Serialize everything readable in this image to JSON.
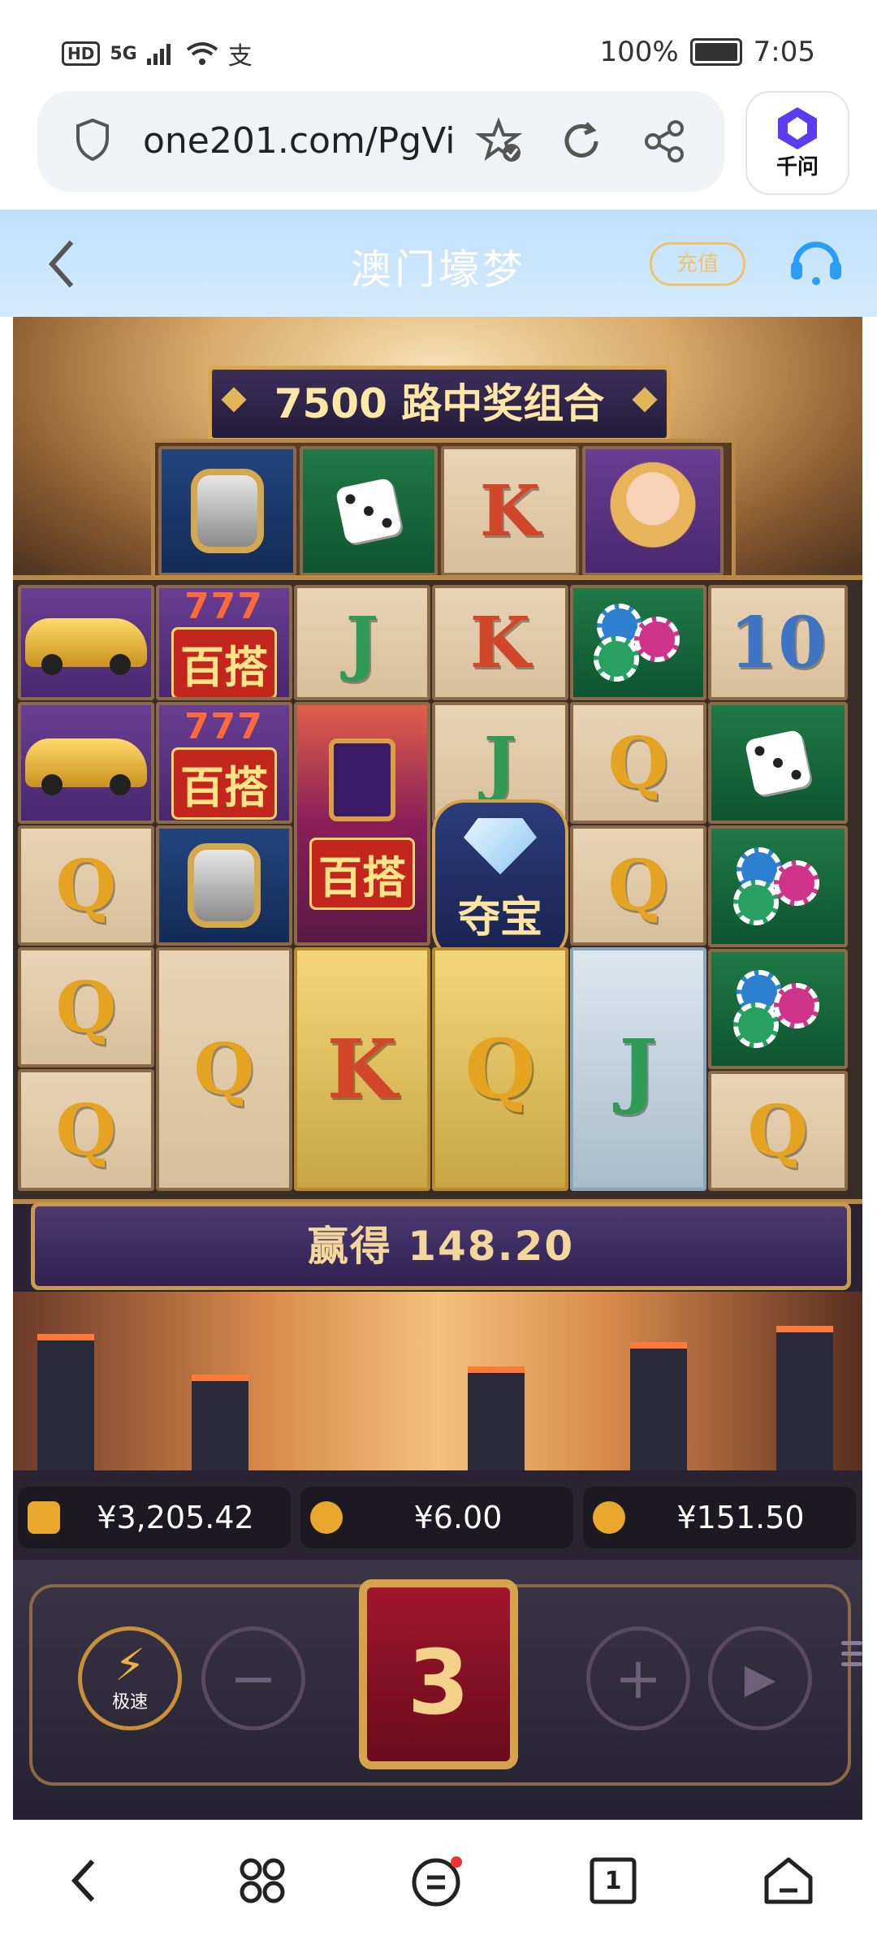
{
  "status": {
    "hd": "HD",
    "signal": "5G",
    "wifi_extra": "支",
    "battery_pct": "100%",
    "time": "7:05"
  },
  "browser": {
    "url": "one201.com/PgVi",
    "assistant_label": "千问"
  },
  "app_header": {
    "title": "澳门壕梦",
    "recharge_label": "充值"
  },
  "game": {
    "banner": "7500 路中奖组合",
    "win_label": "赢得 148.20",
    "balance": "¥3,205.42",
    "bet": "¥6.00",
    "last_win": "¥151.50",
    "turbo_label": "极速",
    "spin_counter": "3",
    "top_row": [
      "watch",
      "dice",
      "K",
      "lady"
    ],
    "grid": [
      [
        "car",
        "baita",
        "J",
        "K",
        "chips",
        "10"
      ],
      [
        "car",
        "baita",
        "baita-big",
        "J",
        "Q",
        "dice"
      ],
      [
        "Q",
        "watch",
        "baita-big",
        "gem",
        "Q",
        "chips"
      ],
      [
        "Q",
        "Q-big",
        "K-big",
        "Q-big",
        "J-big",
        "chips"
      ],
      [
        "Q",
        "Q-big",
        "K-big",
        "Q-big",
        "J-big",
        "Q"
      ]
    ],
    "symbol_texts": {
      "baita_num": "777",
      "baita": "百搭",
      "gem": "夺宝",
      "Q": "Q",
      "K": "K",
      "J": "J",
      "10": "10"
    }
  },
  "colors": {
    "accent_gold": "#d9a74e",
    "header_bg": "#bfe0fb",
    "spin_red": "#a0162c"
  },
  "nav_icons": [
    "back-icon",
    "apps-icon",
    "menu-icon",
    "tabs-icon",
    "home-icon"
  ],
  "nav": {
    "tabs_count": "1"
  }
}
